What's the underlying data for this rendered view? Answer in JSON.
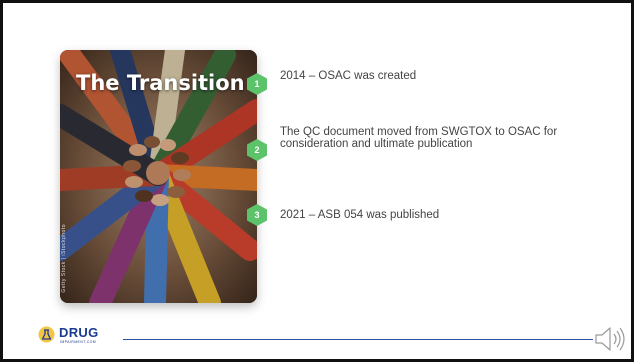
{
  "slide": {
    "title": "The Transition",
    "photo_credit": "Getty Stock | iStockphoto",
    "items": [
      {
        "number": "1",
        "text": "2014 – OSAC was created"
      },
      {
        "number": "2",
        "text": "The QC document moved from SWGTOX to OSAC for consideration and ultimate publication"
      },
      {
        "number": "3",
        "text": "2021 – ASB 054 was published"
      }
    ]
  },
  "footer": {
    "logo_word": "DRUG",
    "logo_sub": "IMPAIRMENT.COM"
  },
  "colors": {
    "accent_green": "#5cc36a",
    "brand_blue": "#1a3b8f",
    "frame_border": "#111111"
  },
  "icons": {
    "speaker": "speaker-icon",
    "logo": "lab-flask-logo-icon"
  }
}
